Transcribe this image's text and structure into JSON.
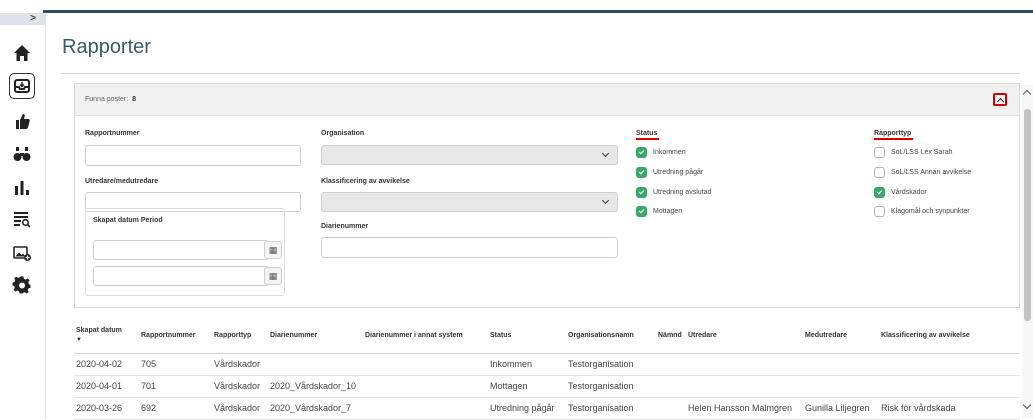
{
  "sidebar": {
    "toggle": ">",
    "icons": [
      "home-icon",
      "inbox-icon",
      "thumbs-up-icon",
      "binoculars-icon",
      "bar-chart-icon",
      "list-search-icon",
      "image-add-icon",
      "gear-icon"
    ]
  },
  "page": {
    "title": "Rapporter"
  },
  "filter": {
    "found_label": "Funna poster:",
    "found_count": "8",
    "rapportnummer_label": "Rapportnummer",
    "utredare_label": "Utredare/medutredare",
    "period_label": "Skapat datum Period",
    "organisation_label": "Organisation",
    "klassificering_label": "Klassificering av avvikelse",
    "diarienummer_label": "Diarienummer",
    "status_title": "Status",
    "status_options": [
      {
        "label": "Inkommen",
        "checked": true
      },
      {
        "label": "Utredning pågår",
        "checked": true
      },
      {
        "label": "Utredning avslutad",
        "checked": true
      },
      {
        "label": "Mottagen",
        "checked": true
      }
    ],
    "rapporttyp_title": "Rapporttyp",
    "rapporttyp_options": [
      {
        "label": "SoL/LSS Lex Sarah",
        "checked": false
      },
      {
        "label": "SoL/LSS Annan avvikelse",
        "checked": false
      },
      {
        "label": "Vårdskador",
        "checked": true
      },
      {
        "label": "Klagomål och synpunkter",
        "checked": false
      }
    ]
  },
  "table": {
    "sort_indicator": "▼",
    "columns": [
      "Skapat datum",
      "Rapportnummer",
      "Rapporttyp",
      "Diarienummer",
      "Diarienummer i annat system",
      "Status",
      "Organisationsnamn",
      "Nämnd",
      "Utredare",
      "Medutredare",
      "Klassificering av avvikelse"
    ],
    "rows": [
      [
        "2020-04-02",
        "705",
        "Vårdskador",
        "",
        "",
        "Inkommen",
        "Testorganisation",
        "",
        "",
        "",
        ""
      ],
      [
        "2020-04-01",
        "701",
        "Vårdskador",
        "2020_Vårdskador_10",
        "",
        "Mottagen",
        "Testorganisation",
        "",
        "",
        "",
        ""
      ],
      [
        "2020-03-26",
        "692",
        "Vårdskador",
        "2020_Vårdskador_7",
        "",
        "Utredning pågår",
        "Testorganisation",
        "",
        "Helen Hansson Malmgren",
        "Gunilla Liljegren",
        "Risk för vårdskada"
      ]
    ]
  },
  "colors": {
    "accent": "#3c5a6e",
    "checkbox_checked": "#3ea56a",
    "highlight": "#d40000",
    "topbar": "#2e4b63"
  }
}
